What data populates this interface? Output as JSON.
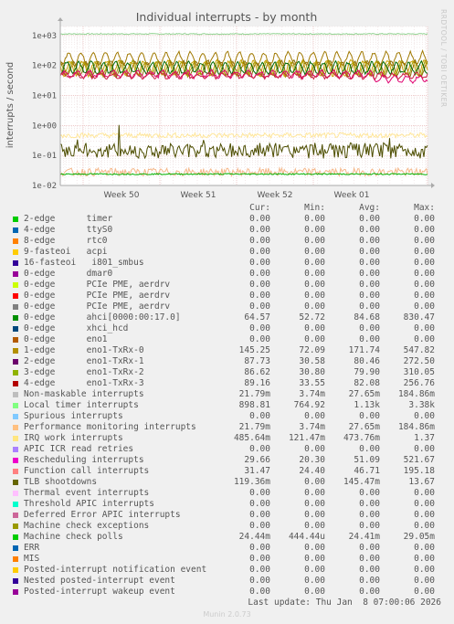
{
  "chart_data": {
    "type": "line",
    "title": "Individual interrupts - by month",
    "ylabel": "interrupts / second",
    "y_scale": "log",
    "ylim": [
      0.01,
      2000
    ],
    "yticks": [
      "1e+03",
      "1e+02",
      "1e+01",
      "1e+00",
      "1e-01",
      "1e-02"
    ],
    "xticks": [
      "Week 50",
      "Week 51",
      "Week 52",
      "Week 01"
    ],
    "grid": true,
    "series": [
      {
        "name": "Local timer interrupts",
        "color": "#8fd18f",
        "level": 1130,
        "noise": 0.04
      },
      {
        "name": "2-edge eno1-TxRx-1",
        "color": "#8c6a00",
        "level": 80,
        "noise": 0.45
      },
      {
        "name": "3-edge eno1-TxRx-2",
        "color": "#9aa000",
        "level": 80,
        "noise": 0.45
      },
      {
        "name": "4-edge eno1-TxRx-3",
        "color": "#c8a000",
        "level": 82,
        "noise": 0.45
      },
      {
        "name": "1-edge eno1-TxRx-0",
        "color": "#a07800",
        "level": 170,
        "noise": 0.4
      },
      {
        "name": "0-edge ahci[0000:00:17.0]",
        "color": "#006600",
        "level": 84,
        "noise": 0.35
      },
      {
        "name": "Rescheduling interrupts",
        "color": "#e00070",
        "level": 51,
        "noise": 0.2
      },
      {
        "name": "Function call interrupts",
        "color": "#cc2244",
        "level": 46,
        "noise": 0.15
      },
      {
        "name": "IRQ work interrupts",
        "color": "#ffe699",
        "level": 0.47,
        "noise": 0.2
      },
      {
        "name": "TLB shootdowns",
        "color": "#4d4d00",
        "level": 0.145,
        "noise": 0.6
      },
      {
        "name": "Performance monitoring interrupts",
        "color": "#f5b88a",
        "level": 0.028,
        "noise": 0.3
      },
      {
        "name": "Machine check polls",
        "color": "#00b000",
        "level": 0.024,
        "noise": 0.05
      }
    ]
  },
  "side_text": "RRDTOOL / TOBI OETIKER",
  "legend": {
    "headers": [
      "Cur:",
      "Min:",
      "Avg:",
      "Max:"
    ],
    "rows": [
      {
        "color": "#00cc00",
        "label": "2-edge      timer",
        "cur": "0.00",
        "min": "0.00",
        "avg": "0.00",
        "max": "0.00"
      },
      {
        "color": "#0066b3",
        "label": "4-edge      ttyS0",
        "cur": "0.00",
        "min": "0.00",
        "avg": "0.00",
        "max": "0.00"
      },
      {
        "color": "#ff8000",
        "label": "8-edge      rtc0",
        "cur": "0.00",
        "min": "0.00",
        "avg": "0.00",
        "max": "0.00"
      },
      {
        "color": "#ffcc00",
        "label": "9-fasteoi   acpi",
        "cur": "0.00",
        "min": "0.00",
        "avg": "0.00",
        "max": "0.00"
      },
      {
        "color": "#330099",
        "label": "16-fasteoi   i801_smbus",
        "cur": "0.00",
        "min": "0.00",
        "avg": "0.00",
        "max": "0.00"
      },
      {
        "color": "#990099",
        "label": "0-edge      dmar0",
        "cur": "0.00",
        "min": "0.00",
        "avg": "0.00",
        "max": "0.00"
      },
      {
        "color": "#ccff00",
        "label": "0-edge      PCIe PME, aerdrv",
        "cur": "0.00",
        "min": "0.00",
        "avg": "0.00",
        "max": "0.00"
      },
      {
        "color": "#ff0000",
        "label": "0-edge      PCIe PME, aerdrv",
        "cur": "0.00",
        "min": "0.00",
        "avg": "0.00",
        "max": "0.00"
      },
      {
        "color": "#808080",
        "label": "0-edge      PCIe PME, aerdrv",
        "cur": "0.00",
        "min": "0.00",
        "avg": "0.00",
        "max": "0.00"
      },
      {
        "color": "#008f00",
        "label": "0-edge      ahci[0000:00:17.0]",
        "cur": "64.57",
        "min": "52.72",
        "avg": "84.68",
        "max": "830.47"
      },
      {
        "color": "#00487d",
        "label": "0-edge      xhci_hcd",
        "cur": "0.00",
        "min": "0.00",
        "avg": "0.00",
        "max": "0.00"
      },
      {
        "color": "#b35a00",
        "label": "0-edge      eno1",
        "cur": "0.00",
        "min": "0.00",
        "avg": "0.00",
        "max": "0.00"
      },
      {
        "color": "#b38f00",
        "label": "1-edge      eno1-TxRx-0",
        "cur": "145.25",
        "min": "72.09",
        "avg": "171.74",
        "max": "547.82"
      },
      {
        "color": "#6b006b",
        "label": "2-edge      eno1-TxRx-1",
        "cur": "87.73",
        "min": "30.58",
        "avg": "80.46",
        "max": "272.50"
      },
      {
        "color": "#8fb300",
        "label": "3-edge      eno1-TxRx-2",
        "cur": "86.62",
        "min": "30.80",
        "avg": "79.90",
        "max": "310.05"
      },
      {
        "color": "#b30000",
        "label": "4-edge      eno1-TxRx-3",
        "cur": "89.16",
        "min": "33.55",
        "avg": "82.08",
        "max": "256.76"
      },
      {
        "color": "#bebebe",
        "label": "Non-maskable interrupts",
        "cur": "21.79m",
        "min": "3.74m",
        "avg": "27.65m",
        "max": "184.86m"
      },
      {
        "color": "#80ff80",
        "label": "Local timer interrupts",
        "cur": "898.81",
        "min": "764.92",
        "avg": "1.13k",
        "max": "3.38k"
      },
      {
        "color": "#80c9ff",
        "label": "Spurious interrupts",
        "cur": "0.00",
        "min": "0.00",
        "avg": "0.00",
        "max": "0.00"
      },
      {
        "color": "#ffc080",
        "label": "Performance monitoring interrupts",
        "cur": "21.79m",
        "min": "3.74m",
        "avg": "27.65m",
        "max": "184.86m"
      },
      {
        "color": "#ffe680",
        "label": "IRQ work interrupts",
        "cur": "485.64m",
        "min": "121.47m",
        "avg": "473.76m",
        "max": "1.37"
      },
      {
        "color": "#aa80ff",
        "label": "APIC ICR read retries",
        "cur": "0.00",
        "min": "0.00",
        "avg": "0.00",
        "max": "0.00"
      },
      {
        "color": "#ee00cc",
        "label": "Rescheduling interrupts",
        "cur": "29.66",
        "min": "20.30",
        "avg": "51.09",
        "max": "521.67"
      },
      {
        "color": "#ff8080",
        "label": "Function call interrupts",
        "cur": "31.47",
        "min": "24.40",
        "avg": "46.71",
        "max": "195.18"
      },
      {
        "color": "#666600",
        "label": "TLB shootdowns",
        "cur": "119.36m",
        "min": "0.00",
        "avg": "145.47m",
        "max": "13.67"
      },
      {
        "color": "#ffbfff",
        "label": "Thermal event interrupts",
        "cur": "0.00",
        "min": "0.00",
        "avg": "0.00",
        "max": "0.00"
      },
      {
        "color": "#00ffcc",
        "label": "Threshold APIC interrupts",
        "cur": "0.00",
        "min": "0.00",
        "avg": "0.00",
        "max": "0.00"
      },
      {
        "color": "#cc6699",
        "label": "Deferred Error APIC interrupts",
        "cur": "0.00",
        "min": "0.00",
        "avg": "0.00",
        "max": "0.00"
      },
      {
        "color": "#999900",
        "label": "Machine check exceptions",
        "cur": "0.00",
        "min": "0.00",
        "avg": "0.00",
        "max": "0.00"
      },
      {
        "color": "#00cc00",
        "label": "Machine check polls",
        "cur": "24.44m",
        "min": "444.44u",
        "avg": "24.41m",
        "max": "29.05m"
      },
      {
        "color": "#0066b3",
        "label": "ERR",
        "cur": "0.00",
        "min": "0.00",
        "avg": "0.00",
        "max": "0.00"
      },
      {
        "color": "#ff8000",
        "label": "MIS",
        "cur": "0.00",
        "min": "0.00",
        "avg": "0.00",
        "max": "0.00"
      },
      {
        "color": "#ffcc00",
        "label": "Posted-interrupt notification event",
        "cur": "0.00",
        "min": "0.00",
        "avg": "0.00",
        "max": "0.00"
      },
      {
        "color": "#330099",
        "label": "Nested posted-interrupt event",
        "cur": "0.00",
        "min": "0.00",
        "avg": "0.00",
        "max": "0.00"
      },
      {
        "color": "#990099",
        "label": "Posted-interrupt wakeup event",
        "cur": "0.00",
        "min": "0.00",
        "avg": "0.00",
        "max": "0.00"
      }
    ],
    "last_update": "Last update: Thu Jan  8 07:00:06 2026"
  },
  "footer": {
    "version": "Munin 2.0.73"
  }
}
